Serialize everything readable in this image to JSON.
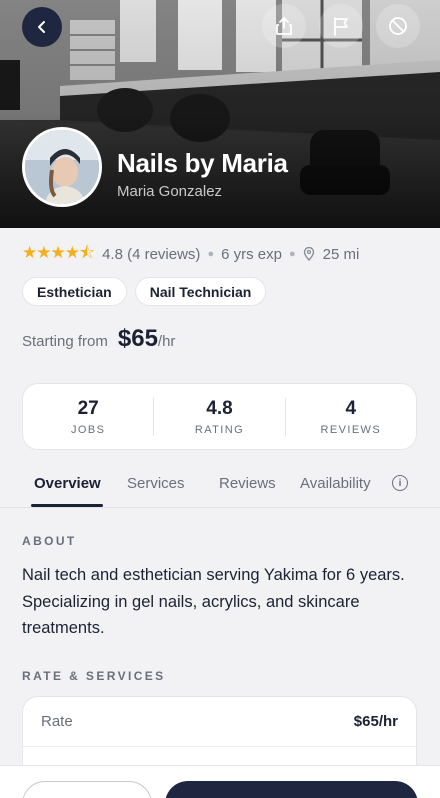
{
  "hero": {
    "name": "Nails by Maria",
    "owner": "Maria Gonzalez",
    "icons": [
      "back-icon",
      "share-icon",
      "flag-icon",
      "block-icon"
    ]
  },
  "meta": {
    "stars": "★★★★⯪",
    "rating_text": "4.8 (4 reviews)",
    "experience": "6 yrs exp",
    "distance": "25 mi"
  },
  "chips": [
    "Esthetician",
    "Nail Technician"
  ],
  "price": {
    "label": "Starting from",
    "value": "$65",
    "unit": "/hr"
  },
  "stats": [
    {
      "value": "27",
      "label": "JOBS"
    },
    {
      "value": "4.8",
      "label": "RATING"
    },
    {
      "value": "4",
      "label": "REVIEWS"
    }
  ],
  "tabs": [
    "Overview",
    "Services",
    "Reviews",
    "Availability"
  ],
  "about": {
    "title": "ABOUT",
    "text": "Nail tech and esthetician serving Yakima for 6 years. Specializing in gel nails, acrylics, and skincare treatments."
  },
  "rates": {
    "title": "RATE & SERVICES",
    "rate_label": "Rate",
    "rate_value": "$65/hr"
  },
  "colors": {
    "accent": "#1f2740",
    "star": "#f3b01c",
    "background": "#f2f2f5"
  }
}
